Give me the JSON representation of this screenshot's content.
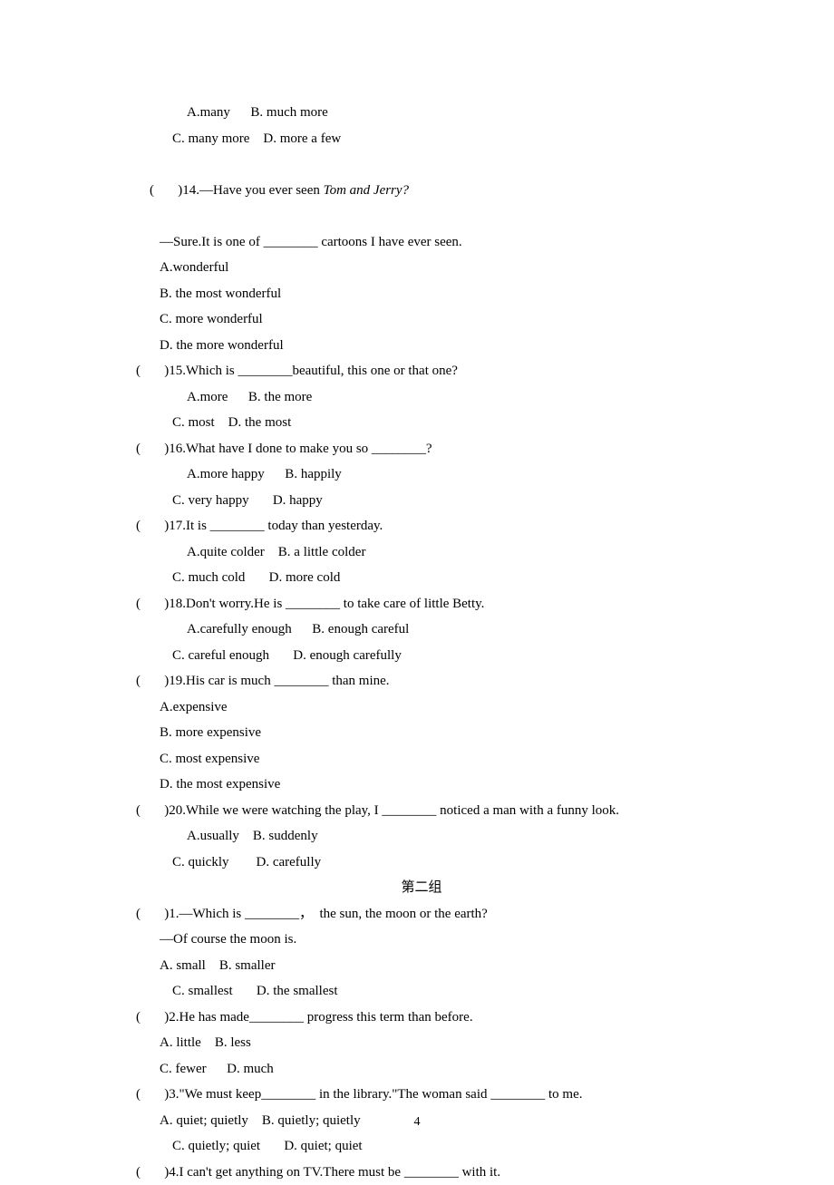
{
  "q13": {
    "optA": "A.many      B. much more",
    "optC": "C. many more    D. more a few"
  },
  "q14": {
    "stem_a": "(       )14.—Have you ever seen ",
    "stem_italic": "Tom and Jerry?",
    "line2": "—Sure.It is one of ________ cartoons I have ever seen.",
    "optA": "A.wonderful",
    "optB": "B. the most wonderful",
    "optC": "C. more wonderful",
    "optD": "D. the more wonderful"
  },
  "q15": {
    "stem": "(       )15.Which is ________beautiful, this one or that one?",
    "optA": "A.more      B. the more",
    "optC": "C. most    D. the most"
  },
  "q16": {
    "stem": "(       )16.What have I done to make you so ________?",
    "optA": "A.more happy      B. happily",
    "optC": "C. very happy       D. happy"
  },
  "q17": {
    "stem": "(       )17.It is ________ today than yesterday.",
    "optA": "A.quite colder    B. a little colder",
    "optC": "C. much cold       D. more cold"
  },
  "q18": {
    "stem": "(       )18.Don't worry.He is ________ to take care of little Betty.",
    "optA": "A.carefully enough      B. enough careful",
    "optC": "C. careful enough       D. enough carefully"
  },
  "q19": {
    "stem": "(       )19.His car is much ________ than mine.",
    "optA": "A.expensive",
    "optB": "B. more expensive",
    "optC": "C. most expensive",
    "optD": "D. the most expensive"
  },
  "q20": {
    "stem": "(       )20.While we were watching the play, I ________ noticed a man with a funny look.",
    "optA": "A.usually    B. suddenly",
    "optC": "C. quickly        D. carefully"
  },
  "section2": "第二组",
  "g2q1": {
    "stem": "(       )1.—Which is ________，  the sun, the moon or the earth?",
    "line2": "—Of course the moon is.",
    "optA": "A. small    B. smaller",
    "optC": "C. smallest       D. the smallest"
  },
  "g2q2": {
    "stem": "(       )2.He has made________ progress this term than before.",
    "optA": "A. little    B. less",
    "optC": "C. fewer      D. much"
  },
  "g2q3": {
    "stem": "(       )3.\"We must keep________ in the library.\"The woman said ________ to me.",
    "optA": "A. quiet; quietly    B. quietly; quietly",
    "optC": "C. quietly; quiet       D. quiet; quiet"
  },
  "g2q4": {
    "stem": "(       )4.I can't get anything on TV.There must be ________ with it."
  },
  "pageNumber": "4"
}
